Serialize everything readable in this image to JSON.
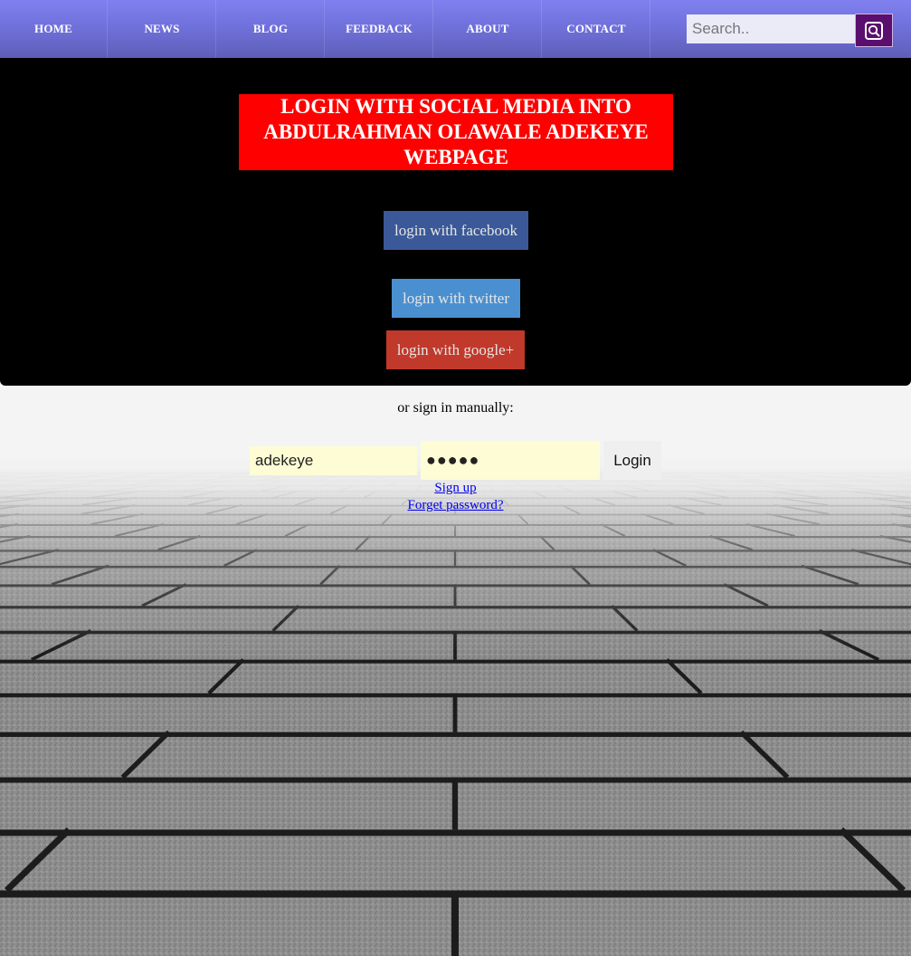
{
  "nav": {
    "items": [
      {
        "label": "HOME"
      },
      {
        "label": "NEWS"
      },
      {
        "label": "BLOG"
      },
      {
        "label": "FEEDBACK"
      },
      {
        "label": "ABOUT"
      },
      {
        "label": "CONTACT"
      }
    ],
    "search": {
      "placeholder": "Search..",
      "button_icon": "search-icon"
    }
  },
  "panel": {
    "title": "LOGIN WITH SOCIAL MEDIA INTO ABDULRAHMAN OLAWALE ADEKEYE WEBPAGE",
    "buttons": {
      "facebook": "login with facebook",
      "twitter": "login with twitter",
      "google": "login with google+"
    }
  },
  "manual": {
    "prompt": "or sign in manually:",
    "username_value": "adekeye",
    "password_value": "●●●●●",
    "login_label": "Login",
    "signup_link": "Sign up",
    "forgot_link": "Forget password?"
  },
  "colors": {
    "nav_gradient_top": "#8080f0",
    "nav_gradient_bottom": "#5e5eb8",
    "title_bg": "#ff0000",
    "facebook": "#3b5998",
    "twitter": "#4a90d0",
    "google": "#c0392b",
    "search_button": "#5a0f6e",
    "field_bg": "#fefcd4"
  },
  "background": {
    "icon": "brick-pavement-image"
  }
}
